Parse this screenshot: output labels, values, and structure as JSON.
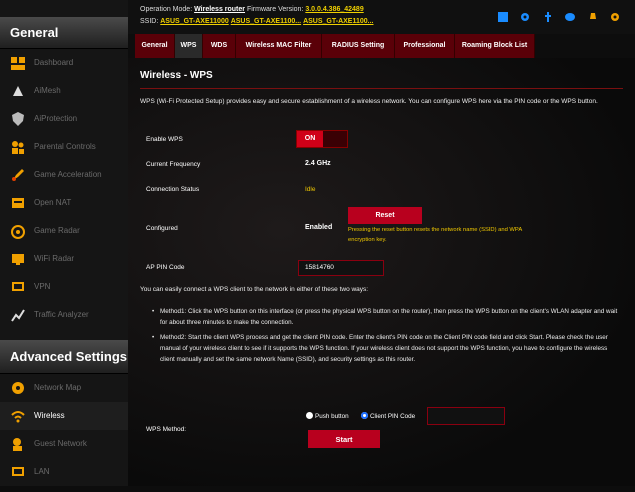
{
  "colors": {
    "accent": "#b8001e",
    "warning": "#f0c800"
  },
  "sidebar": {
    "general_title": "General",
    "advanced_title": "Advanced Settings",
    "general_items": [
      {
        "label": "Dashboard",
        "icon": "dashboard-icon"
      },
      {
        "label": "AiMesh",
        "icon": "aimesh-icon"
      },
      {
        "label": "AiProtection",
        "icon": "shield-icon"
      },
      {
        "label": "Parental Controls",
        "icon": "parental-icon"
      },
      {
        "label": "Game Acceleration",
        "icon": "rocket-icon"
      },
      {
        "label": "Open NAT",
        "icon": "nat-icon"
      },
      {
        "label": "Game Radar",
        "icon": "radar-icon"
      },
      {
        "label": "WiFi Radar",
        "icon": "wifi-radar-icon"
      },
      {
        "label": "VPN",
        "icon": "vpn-icon"
      },
      {
        "label": "Traffic Analyzer",
        "icon": "analyzer-icon"
      }
    ],
    "advanced_items": [
      {
        "label": "Network Map",
        "icon": "network-map-icon"
      },
      {
        "label": "Wireless",
        "icon": "wireless-icon"
      },
      {
        "label": "Guest Network",
        "icon": "guest-network-icon"
      },
      {
        "label": "LAN",
        "icon": "lan-icon"
      }
    ]
  },
  "header": {
    "opmode_label": "Operation Mode:",
    "opmode_value": "Wireless router",
    "firmware_label": "Firmware Version:",
    "firmware_value": "3.0.0.4.386_42489",
    "ssid_label": "SSID:",
    "ssid_values": [
      "ASUS_GT-AXE11000",
      "ASUS_GT-AXE1100...",
      "ASUS_GT-AXE1100..."
    ]
  },
  "tabs": [
    "General",
    "WPS",
    "WDS",
    "Wireless MAC Filter",
    "RADIUS Setting",
    "Professional",
    "Roaming Block List"
  ],
  "page": {
    "title": "Wireless - WPS",
    "description": "WPS (Wi-Fi Protected Setup) provides easy and secure establishment of a wireless network. You can configure WPS here via the PIN code or the WPS button.",
    "enable_label": "Enable WPS",
    "toggle_label": "ON",
    "freq_label": "Current Frequency",
    "freq_value": "2.4 GHz",
    "status_label": "Connection Status",
    "status_value": "Idle",
    "configured_label": "Configured",
    "configured_value": "Enabled",
    "reset_label": "Reset",
    "reset_note": "Pressing the reset button resets the network name (SSID) and WPA encryption key.",
    "pin_label": "AP PIN Code",
    "pin_value": "15814760",
    "ways_text": "You can easily connect a WPS client to the network in either of these two ways:",
    "method1": "Method1: Click the WPS button on this interface (or press the physical WPS button on the router), then press the WPS button on the client's WLAN adapter and wait for about three minutes to make the connection.",
    "method2": "Method2: Start the client WPS process and get the client PIN code. Enter the client's PIN code on the Client PIN code field and click Start. Please check the user manual of your wireless client to see if it supports the WPS function. If your wireless client does not support the WPS function, you have to configure the wireless client manually and set the same network Name (SSID), and security settings as this router.",
    "method_label": "WPS Method:",
    "push_label": "Push button",
    "client_pin_label": "Client PIN Code",
    "start_label": "Start"
  }
}
